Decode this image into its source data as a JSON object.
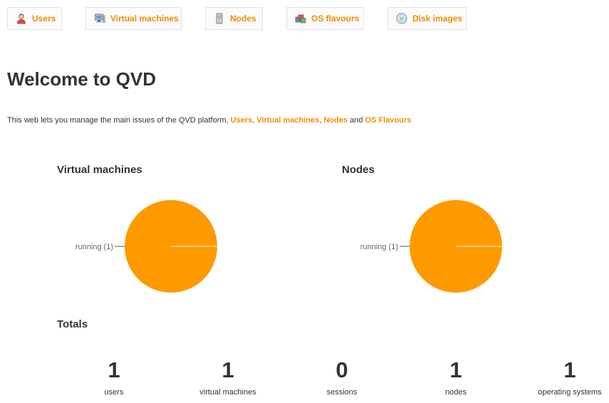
{
  "nav": {
    "items": [
      {
        "label": "Users",
        "icon": "user-icon"
      },
      {
        "label": "Virtual machines",
        "icon": "computer-icon"
      },
      {
        "label": "Nodes",
        "icon": "server-icon"
      },
      {
        "label": "OS flavours",
        "icon": "os-flavour-icon"
      },
      {
        "label": "Disk images",
        "icon": "disk-icon"
      }
    ]
  },
  "welcome": {
    "title": "Welcome to QVD",
    "intro_text": "This web lets you manage the main issues of the QVD platform,",
    "link_users": "Users",
    "sep1": ",",
    "link_vms": "Virtual machines",
    "sep2": ",",
    "link_nodes": "Nodes",
    "sep_and": "and",
    "link_os": "OS Flavours"
  },
  "charts": {
    "vms": {
      "title": "Virtual machines",
      "slices": [
        {
          "label": "running (1)",
          "value": 1
        }
      ]
    },
    "nodes": {
      "title": "Nodes",
      "slices": [
        {
          "label": "running (1)",
          "value": 1
        }
      ]
    }
  },
  "chart_data": [
    {
      "type": "pie",
      "title": "Virtual machines",
      "categories": [
        "running"
      ],
      "values": [
        1
      ],
      "labels": [
        "running (1)"
      ]
    },
    {
      "type": "pie",
      "title": "Nodes",
      "categories": [
        "running"
      ],
      "values": [
        1
      ],
      "labels": [
        "running (1)"
      ]
    }
  ],
  "totals": {
    "title": "Totals",
    "items": [
      {
        "value": "1",
        "label": "users"
      },
      {
        "value": "1",
        "label": "virtual machines"
      },
      {
        "value": "0",
        "label": "sessions"
      },
      {
        "value": "1",
        "label": "nodes"
      },
      {
        "value": "1",
        "label": "operating systems"
      }
    ]
  },
  "colors": {
    "accent": "#f28c00",
    "pie_fill": "#ff9900",
    "text": "#333333"
  }
}
